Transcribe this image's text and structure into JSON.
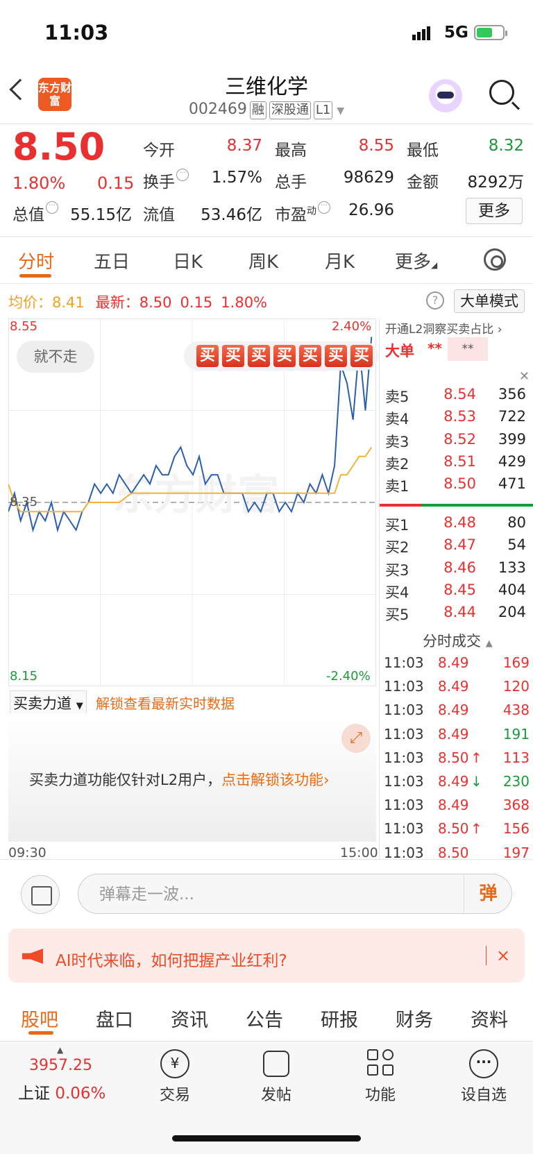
{
  "status": {
    "time": "11:03",
    "network": "5G"
  },
  "header": {
    "logo": "东方财富",
    "name": "三维化学",
    "code": "002469",
    "tags": [
      "融",
      "深股通",
      "L1"
    ]
  },
  "quote": {
    "price": "8.50",
    "pct": "1.80%",
    "change": "0.15",
    "fields": [
      {
        "label": "今开",
        "value": "8.37",
        "color": "#e93030"
      },
      {
        "label": "最高",
        "value": "8.55",
        "color": "#e93030"
      },
      {
        "label": "最低",
        "value": "8.32",
        "color": "#1a9a3a"
      },
      {
        "label": "换手",
        "value": "1.57%"
      },
      {
        "label": "总手",
        "value": "98629"
      },
      {
        "label": "金额",
        "value": "8292万"
      },
      {
        "label": "总值",
        "value": "55.15亿"
      },
      {
        "label": "流值",
        "value": "53.46亿"
      },
      {
        "label": "市盈",
        "value": "26.96",
        "sup": "动"
      }
    ],
    "more": "更多"
  },
  "tabs": [
    "分时",
    "五日",
    "日K",
    "周K",
    "月K",
    "更多"
  ],
  "chart_info": {
    "avg_label": "均价：",
    "avg": "8.41",
    "last_label": "最新：",
    "last": "8.50",
    "chg": "0.15",
    "pct": "1.80%",
    "big_mode": "大单模式"
  },
  "chart_data": {
    "type": "line",
    "ylim": [
      8.15,
      8.55
    ],
    "ref_price": 8.35,
    "y_top_label": "8.55",
    "y_mid_label": "8.35",
    "y_bottom_label": "8.15",
    "pct_top": "2.40%",
    "pct_bottom": "-2.40%",
    "x_start": "09:30",
    "x_end": "15:00",
    "series": [
      {
        "color": "#2a5fb0",
        "values": [
          8.34,
          8.36,
          8.33,
          8.35,
          8.32,
          8.34,
          8.33,
          8.35,
          8.32,
          8.34,
          8.33,
          8.32,
          8.34,
          8.35,
          8.37,
          8.36,
          8.37,
          8.36,
          8.38,
          8.37,
          8.36,
          8.37,
          8.38,
          8.37,
          8.39,
          8.38,
          8.38,
          8.4,
          8.41,
          8.39,
          8.38,
          8.4,
          8.37,
          8.38,
          8.38,
          8.36,
          8.36,
          8.36,
          8.36,
          8.34,
          8.35,
          8.34,
          8.36,
          8.36,
          8.34,
          8.35,
          8.34,
          8.36,
          8.35,
          8.37,
          8.36,
          8.38,
          8.36,
          8.39,
          8.5,
          8.48,
          8.44,
          8.52,
          8.45,
          8.53
        ]
      },
      {
        "color": "#f2b33d",
        "values": [
          8.37,
          8.35,
          8.34,
          8.34,
          8.34,
          8.34,
          8.34,
          8.34,
          8.34,
          8.34,
          8.34,
          8.34,
          8.34,
          8.35,
          8.35,
          8.35,
          8.35,
          8.35,
          8.35,
          8.355,
          8.36,
          8.36,
          8.36,
          8.36,
          8.36,
          8.36,
          8.36,
          8.36,
          8.36,
          8.36,
          8.36,
          8.36,
          8.36,
          8.36,
          8.36,
          8.36,
          8.36,
          8.36,
          8.36,
          8.36,
          8.36,
          8.36,
          8.36,
          8.36,
          8.36,
          8.36,
          8.36,
          8.36,
          8.36,
          8.36,
          8.36,
          8.36,
          8.36,
          8.36,
          8.38,
          8.38,
          8.39,
          8.4,
          8.4,
          8.41
        ]
      }
    ]
  },
  "overlays": {
    "jiubuzou": "就不走",
    "buy_chip": "买",
    "buy_count": 7
  },
  "force": {
    "label": "买卖力道",
    "unlock": "解锁查看最新实时数据",
    "msg": "买卖力道功能仅针对L2用户，",
    "msg_link": "点击解锁该功能"
  },
  "l2": {
    "head": "开通L2洞察买卖占比",
    "dadan": "大单",
    "stars": "**",
    "box": "**"
  },
  "asks": [
    {
      "n": "卖5",
      "p": "8.54",
      "v": "356"
    },
    {
      "n": "卖4",
      "p": "8.53",
      "v": "722"
    },
    {
      "n": "卖3",
      "p": "8.52",
      "v": "399"
    },
    {
      "n": "卖2",
      "p": "8.51",
      "v": "429"
    },
    {
      "n": "卖1",
      "p": "8.50",
      "v": "471"
    }
  ],
  "bids": [
    {
      "n": "买1",
      "p": "8.48",
      "v": "80"
    },
    {
      "n": "买2",
      "p": "8.47",
      "v": "54"
    },
    {
      "n": "买3",
      "p": "8.46",
      "v": "133"
    },
    {
      "n": "买4",
      "p": "8.45",
      "v": "404"
    },
    {
      "n": "买5",
      "p": "8.44",
      "v": "204"
    }
  ],
  "trades_head": "分时成交",
  "trades": [
    {
      "t": "11:03",
      "p": "8.49",
      "a": "",
      "v": "169",
      "vc": "#e93030"
    },
    {
      "t": "11:03",
      "p": "8.49",
      "a": "",
      "v": "120",
      "vc": "#e93030"
    },
    {
      "t": "11:03",
      "p": "8.49",
      "a": "",
      "v": "438",
      "vc": "#e93030"
    },
    {
      "t": "11:03",
      "p": "8.49",
      "a": "",
      "v": "191",
      "vc": "#1a9a3a"
    },
    {
      "t": "11:03",
      "p": "8.50",
      "a": "↑",
      "v": "113",
      "vc": "#e93030"
    },
    {
      "t": "11:03",
      "p": "8.49",
      "a": "↓",
      "v": "230",
      "vc": "#1a9a3a"
    },
    {
      "t": "11:03",
      "p": "8.49",
      "a": "",
      "v": "368",
      "vc": "#e93030"
    },
    {
      "t": "11:03",
      "p": "8.50",
      "a": "↑",
      "v": "156",
      "vc": "#e93030"
    },
    {
      "t": "11:03",
      "p": "8.50",
      "a": "",
      "v": "197",
      "vc": "#e93030"
    }
  ],
  "danmu": {
    "placeholder": "弹幕走一波...",
    "btn": "弹"
  },
  "banner": {
    "text": "AI时代来临，如何把握产业红利?",
    "close": "×"
  },
  "bottom_tabs": [
    "股吧",
    "盘口",
    "资讯",
    "公告",
    "研报",
    "财务",
    "资料"
  ],
  "nav": {
    "index_value": "3957.25",
    "index_name": "上证",
    "index_pct": "0.06%",
    "items": [
      "交易",
      "发帖",
      "功能",
      "设自选"
    ]
  }
}
